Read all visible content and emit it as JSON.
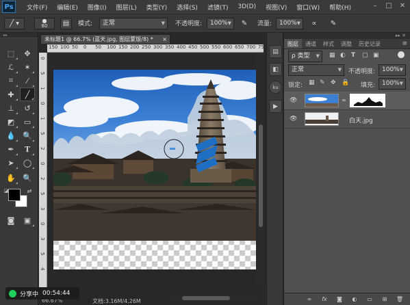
{
  "app": {
    "logo": "Ps"
  },
  "menu": [
    "文件(F)",
    "编辑(E)",
    "图像(I)",
    "图层(L)",
    "类型(Y)",
    "选择(S)",
    "滤镜(T)",
    "3D(D)",
    "视图(V)",
    "窗口(W)",
    "帮助(H)"
  ],
  "window_controls": [
    "–",
    "□",
    "✕"
  ],
  "options": {
    "brush_size": "80",
    "mode_label": "模式:",
    "mode_value": "正常",
    "opacity_label": "不透明度:",
    "opacity_value": "100%",
    "flow_label": "流量:",
    "flow_value": "100%"
  },
  "document": {
    "tab_title": "未标题1 @ 66.7% (蓝天.jpg, 图层蒙版/8) *",
    "tab_close": "×",
    "ruler_top": [
      "150",
      "100",
      "50",
      "0",
      "50",
      "100",
      "150",
      "200",
      "250",
      "300",
      "350",
      "400",
      "450",
      "500",
      "550",
      "600",
      "650",
      "700",
      "750"
    ],
    "ruler_left": [
      "0",
      "5",
      "1",
      "0",
      "1",
      "5",
      "2",
      "0",
      "2",
      "5",
      "3",
      "0",
      "3",
      "5",
      "4"
    ],
    "status_zoom": "66.67%",
    "status_doc": "文档:3.16M/4.26M"
  },
  "layers_panel": {
    "tabs": [
      "图层",
      "通道",
      "样式",
      "调整",
      "历史记录"
    ],
    "filter_label": "ρ 类型",
    "blend_mode": "正常",
    "opacity_label": "不透明度:",
    "opacity_value": "100%",
    "lock_label": "锁定:",
    "fill_label": "填充:",
    "fill_value": "100%",
    "layers": [
      {
        "name": "",
        "selected": true,
        "has_mask": true
      },
      {
        "name": "白天.jpg",
        "selected": false,
        "has_mask": false
      }
    ],
    "bottom_icons": [
      "link-icon",
      "fx-icon",
      "mask-icon",
      "adjustment-icon",
      "group-icon",
      "new-layer-icon",
      "trash-icon"
    ],
    "bottom_glyphs": [
      "∞",
      "fx",
      "◙",
      "◐",
      "▭",
      "⊞",
      "🗑"
    ]
  },
  "share": {
    "label": "分享中",
    "time": "00:54:44"
  }
}
